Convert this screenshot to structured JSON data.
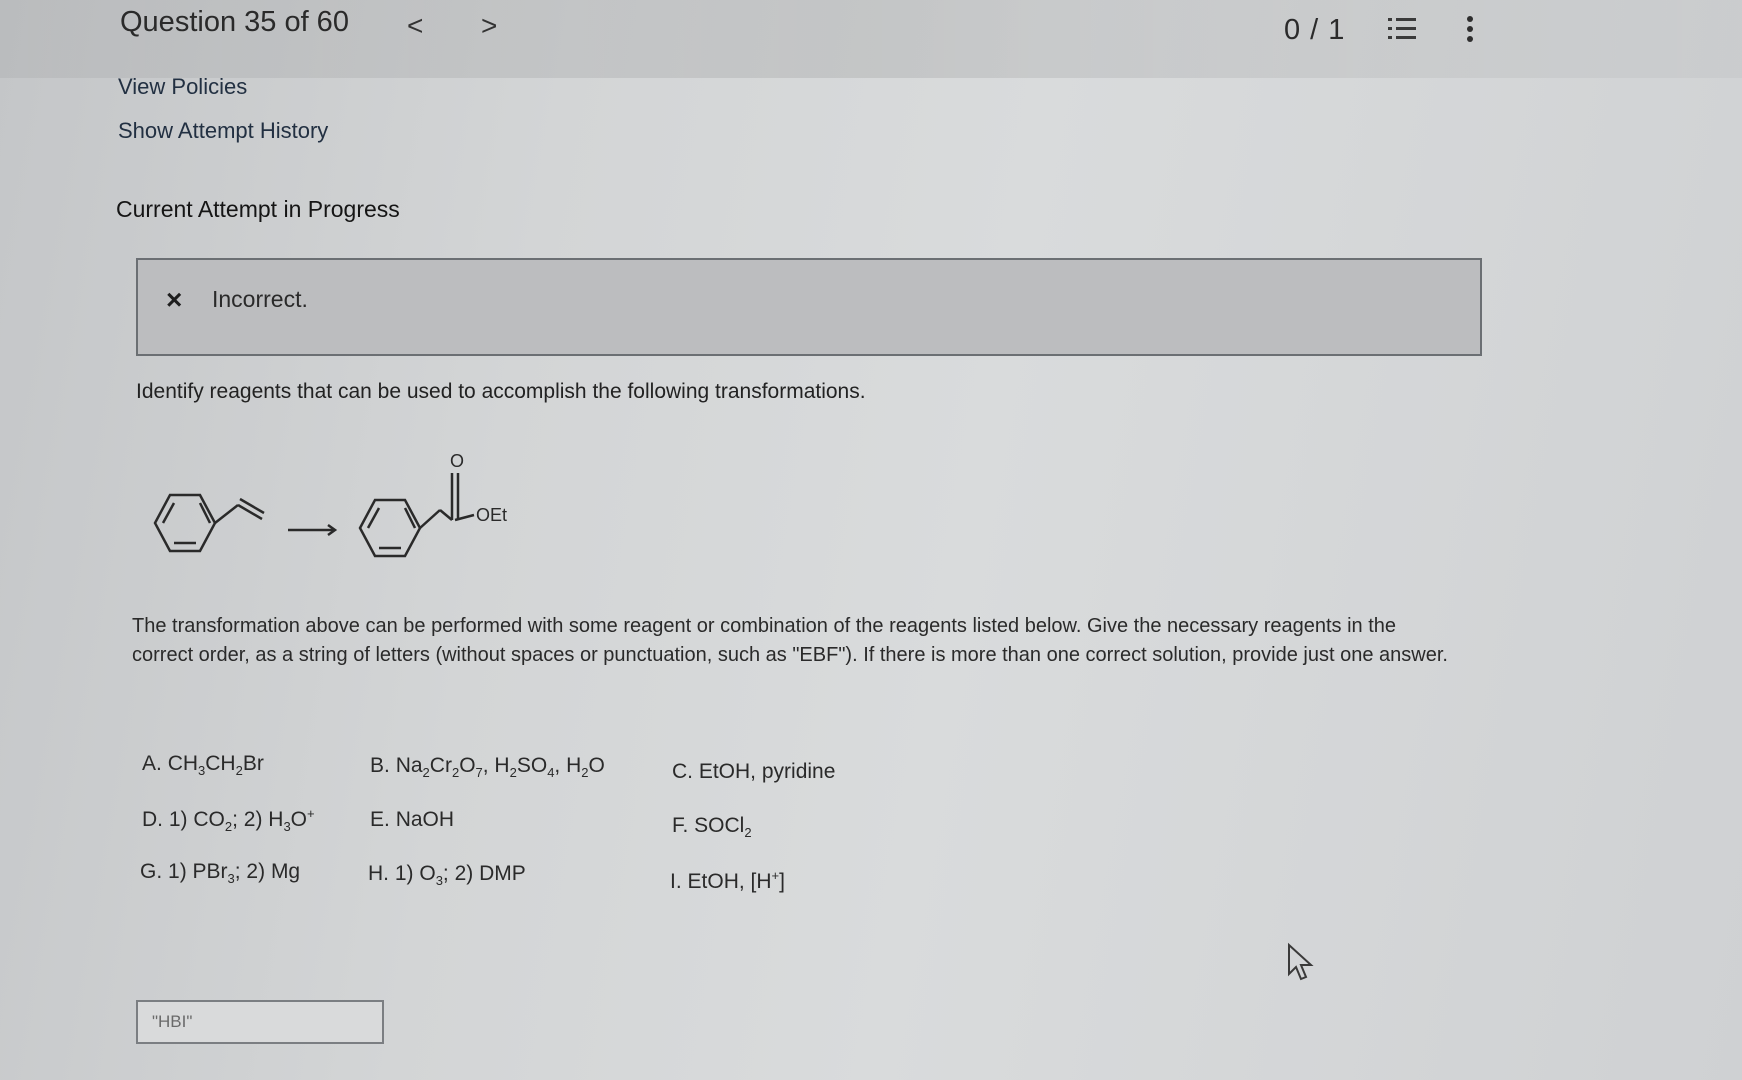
{
  "header": {
    "question_label": "Question 35 of 60",
    "prev_glyph": "<",
    "next_glyph": ">",
    "score": "0 / 1",
    "list_icon": "list-icon",
    "more_icon": "more-vert-icon"
  },
  "links": {
    "view_policies": "View Policies",
    "show_attempt_history": "Show Attempt History"
  },
  "attempt": {
    "title": "Current Attempt in Progress"
  },
  "feedback": {
    "icon": "×",
    "message": "Incorrect."
  },
  "question": {
    "prompt": "Identify reagents that can be used to accomplish the following transformations.",
    "product_label": "OEt",
    "product_o": "O",
    "description": "The transformation above can be performed with some reagent or combination of the reagents listed below. Give the necessary reagents in the correct order, as a string of letters (without spaces or punctuation, such as \"EBF\"). If there is more than one correct solution, provide just one answer."
  },
  "options": [
    {
      "letter": "A.",
      "parts": [
        "CH",
        "3",
        "CH",
        "2",
        "Br"
      ]
    },
    {
      "letter": "B.",
      "parts": [
        "Na",
        "2",
        "Cr",
        "2",
        "O",
        "7",
        ", H",
        "2",
        "SO",
        "4",
        ", H",
        "2",
        "O"
      ]
    },
    {
      "letter": "C.",
      "parts": [
        "EtOH, pyridine"
      ]
    },
    {
      "letter": "D.",
      "parts": [
        "1) CO",
        "2",
        "; 2) H",
        "3",
        "O",
        "+"
      ]
    },
    {
      "letter": "E.",
      "parts": [
        "NaOH"
      ]
    },
    {
      "letter": "F.",
      "parts": [
        "SOCl",
        "2"
      ]
    },
    {
      "letter": "G.",
      "parts": [
        "1) PBr",
        "3",
        "; 2) Mg"
      ]
    },
    {
      "letter": "H.",
      "parts": [
        "1) O",
        "3",
        "; 2) DMP"
      ]
    },
    {
      "letter": "I.",
      "parts": [
        "EtOH, [H",
        "+",
        "]"
      ]
    }
  ],
  "answer": {
    "value": "\"HBI\""
  }
}
